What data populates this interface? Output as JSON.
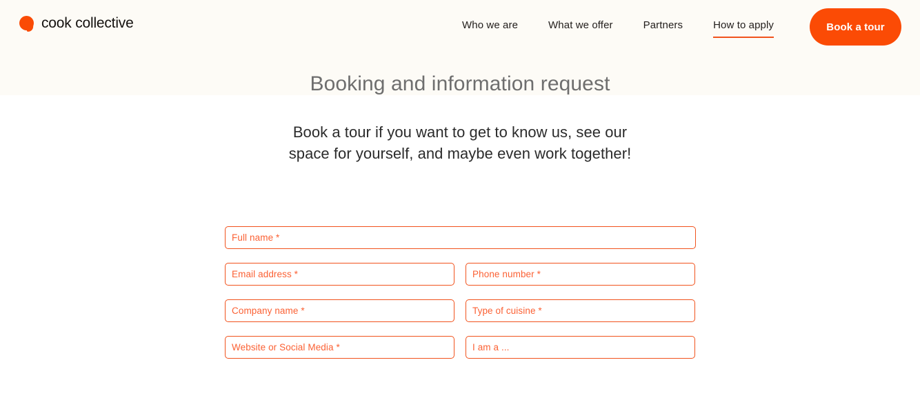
{
  "brand": {
    "name": "cook collective",
    "logo_icon": "speech-bubble-icon",
    "accent_color": "#fb4b05",
    "underline_color": "#f1521c",
    "header_background": "#fdfbf6"
  },
  "nav": {
    "items": [
      {
        "label": "Who we are",
        "active": false
      },
      {
        "label": "What we offer",
        "active": false
      },
      {
        "label": "Partners",
        "active": false
      },
      {
        "label": "How to apply",
        "active": true
      }
    ],
    "cta_label": "Book a tour"
  },
  "page": {
    "title": "Booking and information request",
    "subtitle_line1": "Book a tour if you want to get to know us, see our",
    "subtitle_line2": "space for yourself, and maybe even work together!"
  },
  "form": {
    "fields": [
      {
        "name": "full-name",
        "placeholder": "Full name *",
        "value": "",
        "width": "full"
      },
      {
        "name": "email-address",
        "placeholder": "Email address *",
        "value": "",
        "width": "half"
      },
      {
        "name": "phone-number",
        "placeholder": "Phone number *",
        "value": "",
        "width": "half"
      },
      {
        "name": "company-name",
        "placeholder": "Company name *",
        "value": "",
        "width": "half"
      },
      {
        "name": "type-of-cuisine",
        "placeholder": "Type of cuisine *",
        "value": "",
        "width": "half"
      },
      {
        "name": "website-or-social-media",
        "placeholder": "Website or Social Media *",
        "value": "",
        "width": "half"
      },
      {
        "name": "i-am-a",
        "placeholder": "I am a ...",
        "value": "",
        "width": "half"
      }
    ]
  }
}
